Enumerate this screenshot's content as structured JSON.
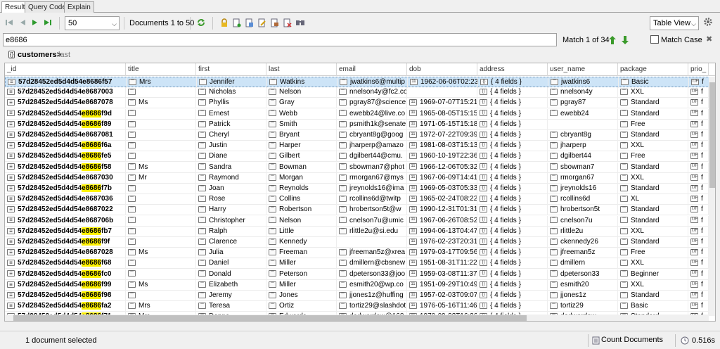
{
  "tabs": [
    {
      "label": "Result",
      "active": true
    },
    {
      "label": "Query Code",
      "active": false
    },
    {
      "label": "Explain",
      "active": false
    }
  ],
  "toolbar": {
    "page_size": "50",
    "documents_label": "Documents 1 to 50",
    "view_mode": "Table View"
  },
  "search": {
    "value": "e8686",
    "match_text": "Match 1 of 34",
    "match_case_label": "Match Case",
    "match_case_checked": false
  },
  "breadcrumb": {
    "collection": "customers>",
    "field": "last"
  },
  "columns": [
    "_id",
    "title",
    "first",
    "last",
    "email",
    "dob",
    "address",
    "user_name",
    "package",
    "prio_"
  ],
  "rows": [
    {
      "id_prefix": "57d28452ed5d4d54e8686f57",
      "id_hl": "",
      "id_suffix": "",
      "title": "Mrs",
      "first": "Jennifer",
      "last": "Watkins",
      "email": "jwatkins6@multip",
      "dob": "1962-06-06T02:23",
      "address": "{ 4 fields }",
      "user_name": "jwatkins6",
      "package": "Basic",
      "prio": "f",
      "selected": true
    },
    {
      "id_prefix": "57d28452ed5d4d54e8687003",
      "id_hl": "",
      "id_suffix": "",
      "title": "",
      "first": "Nicholas",
      "last": "Nelson",
      "email": "nnelson4y@fc2.co",
      "dob": "",
      "address": "{ 4 fields }",
      "user_name": "nnelson4y",
      "package": "XXL",
      "prio": "f"
    },
    {
      "id_prefix": "57d28452ed5d4d54e8687078",
      "id_hl": "",
      "id_suffix": "",
      "title": "Ms",
      "first": "Phyllis",
      "last": "Gray",
      "email": "pgray87@science",
      "dob": "1969-07-07T15:21",
      "address": "{ 4 fields }",
      "user_name": "pgray87",
      "package": "Standard",
      "prio": "f"
    },
    {
      "id_prefix": "57d28452ed5d4d54",
      "id_hl": "e8686",
      "id_suffix": "f9d",
      "title": "",
      "first": "Ernest",
      "last": "Webb",
      "email": "ewebb24@live.co",
      "dob": "1965-08-05T15:15",
      "address": "{ 4 fields }",
      "user_name": "ewebb24",
      "package": "Standard",
      "prio": "f"
    },
    {
      "id_prefix": "57d28452ed5d4d54",
      "id_hl": "e8686",
      "id_suffix": "f89",
      "title": "",
      "first": "Patrick",
      "last": "Smith",
      "email": "psmith1k@senate",
      "dob": "1971-05-15T15:18",
      "address": "{ 4 fields }",
      "user_name": "",
      "package": "Free",
      "prio": "f"
    },
    {
      "id_prefix": "57d28452ed5d4d54e8687081",
      "id_hl": "",
      "id_suffix": "",
      "title": "",
      "first": "Cheryl",
      "last": "Bryant",
      "email": "cbryant8g@goog",
      "dob": "1972-07-22T09:39",
      "address": "{ 4 fields }",
      "user_name": "cbryant8g",
      "package": "Standard",
      "prio": "f"
    },
    {
      "id_prefix": "57d28452ed5d4d54",
      "id_hl": "e8686",
      "id_suffix": "f6a",
      "title": "",
      "first": "Justin",
      "last": "Harper",
      "email": "jharperp@amazo",
      "dob": "1981-08-03T15:13",
      "address": "{ 4 fields }",
      "user_name": "jharperp",
      "package": "XXL",
      "prio": "f"
    },
    {
      "id_prefix": "57d28452ed5d4d54",
      "id_hl": "e8686",
      "id_suffix": "fe5",
      "title": "",
      "first": "Diane",
      "last": "Gilbert",
      "email": "dgilbert44@cmu.",
      "dob": "1960-10-19T22:36",
      "address": "{ 4 fields }",
      "user_name": "dgilbert44",
      "package": "Free",
      "prio": "f"
    },
    {
      "id_prefix": "57d28452ed5d4d54",
      "id_hl": "e8686",
      "id_suffix": "f58",
      "title": "Ms",
      "first": "Sandra",
      "last": "Bowman",
      "email": "sbowman7@phot",
      "dob": "1966-12-06T05:32",
      "address": "{ 4 fields }",
      "user_name": "sbowman7",
      "package": "Standard",
      "prio": "f"
    },
    {
      "id_prefix": "57d28452ed5d4d54e8687030",
      "id_hl": "",
      "id_suffix": "",
      "title": "Mr",
      "first": "Raymond",
      "last": "Morgan",
      "email": "rmorgan67@mys",
      "dob": "1967-06-09T14:41",
      "address": "{ 4 fields }",
      "user_name": "rmorgan67",
      "package": "XXL",
      "prio": "f"
    },
    {
      "id_prefix": "57d28452ed5d4d54",
      "id_hl": "e8686",
      "id_suffix": "f7b",
      "title": "",
      "first": "Joan",
      "last": "Reynolds",
      "email": "jreynolds16@ima",
      "dob": "1969-05-03T05:33",
      "address": "{ 4 fields }",
      "user_name": "jreynolds16",
      "package": "Standard",
      "prio": "f"
    },
    {
      "id_prefix": "57d28452ed5d4d54e8687036",
      "id_hl": "",
      "id_suffix": "",
      "title": "",
      "first": "Rose",
      "last": "Collins",
      "email": "rcollins6d@twitp",
      "dob": "1965-02-24T08:22",
      "address": "{ 4 fields }",
      "user_name": "rcollins6d",
      "package": "XL",
      "prio": "f"
    },
    {
      "id_prefix": "57d28452ed5d4d54e8687022",
      "id_hl": "",
      "id_suffix": "",
      "title": "",
      "first": "Harry",
      "last": "Robertson",
      "email": "hrobertson5t@w",
      "dob": "1990-12-31T01:31",
      "address": "{ 4 fields }",
      "user_name": "hrobertson5t",
      "package": "Standard",
      "prio": "f"
    },
    {
      "id_prefix": "57d28452ed5d4d54e868706b",
      "id_hl": "",
      "id_suffix": "",
      "title": "",
      "first": "Christopher",
      "last": "Nelson",
      "email": "cnelson7u@umic",
      "dob": "1967-06-26T08:52",
      "address": "{ 4 fields }",
      "user_name": "cnelson7u",
      "package": "Standard",
      "prio": "f"
    },
    {
      "id_prefix": "57d28452ed5d4d54",
      "id_hl": "e8686",
      "id_suffix": "fb7",
      "title": "",
      "first": "Ralph",
      "last": "Little",
      "email": "rlittle2u@si.edu",
      "dob": "1994-06-13T04:47",
      "address": "{ 4 fields }",
      "user_name": "rlittle2u",
      "package": "XXL",
      "prio": "f"
    },
    {
      "id_prefix": "57d28452ed5d4d54",
      "id_hl": "e8686",
      "id_suffix": "f9f",
      "title": "",
      "first": "Clarence",
      "last": "Kennedy",
      "email": "",
      "dob": "1976-02-23T20:31",
      "address": "{ 4 fields }",
      "user_name": "ckennedy26",
      "package": "Standard",
      "prio": "f"
    },
    {
      "id_prefix": "57d28452ed5d4d54e8687028",
      "id_hl": "",
      "id_suffix": "",
      "title": "Ms",
      "first": "Julia",
      "last": "Freeman",
      "email": "jfreeman5z@xrea",
      "dob": "1979-03-17T09:56",
      "address": "{ 4 fields }",
      "user_name": "jfreeman5z",
      "package": "Free",
      "prio": "f"
    },
    {
      "id_prefix": "57d28452ed5d4d54",
      "id_hl": "e8686",
      "id_suffix": "f68",
      "title": "",
      "first": "Daniel",
      "last": "Miller",
      "email": "dmillern@cbsnew",
      "dob": "1951-08-31T11:22",
      "address": "{ 4 fields }",
      "user_name": "dmillern",
      "package": "XXL",
      "prio": "f"
    },
    {
      "id_prefix": "57d28452ed5d4d54",
      "id_hl": "e8686",
      "id_suffix": "fc0",
      "title": "",
      "first": "Donald",
      "last": "Peterson",
      "email": "dpeterson33@joo",
      "dob": "1959-03-08T11:37",
      "address": "{ 4 fields }",
      "user_name": "dpeterson33",
      "package": "Beginner",
      "prio": "f"
    },
    {
      "id_prefix": "57d28452ed5d4d54",
      "id_hl": "e8686",
      "id_suffix": "f99",
      "title": "Ms",
      "first": "Elizabeth",
      "last": "Miller",
      "email": "esmith20@wp.co",
      "dob": "1951-09-29T10:49",
      "address": "{ 4 fields }",
      "user_name": "esmith20",
      "package": "XXL",
      "prio": "f"
    },
    {
      "id_prefix": "57d28452ed5d4d54",
      "id_hl": "e8686",
      "id_suffix": "f98",
      "title": "",
      "first": "Jeremy",
      "last": "Jones",
      "email": "jjones1z@huffing",
      "dob": "1957-02-03T09:07",
      "address": "{ 4 fields }",
      "user_name": "jjones1z",
      "package": "Standard",
      "prio": "f"
    },
    {
      "id_prefix": "57d28452ed5d4d54",
      "id_hl": "e8686",
      "id_suffix": "fa2",
      "title": "Mrs",
      "first": "Teresa",
      "last": "Ortiz",
      "email": "tortiz29@slashdot",
      "dob": "1976-05-16T11:46",
      "address": "{ 4 fields }",
      "user_name": "tortiz29",
      "package": "Basic",
      "prio": "f"
    },
    {
      "id_prefix": "57d28452ed5d4d54",
      "id_hl": "e8686",
      "id_suffix": "f71",
      "title": "Mrs",
      "first": "Donna",
      "last": "Edwards",
      "email": "dedwardsw@168",
      "dob": "1970-09-22T16:26",
      "address": "{ 4 fields }",
      "user_name": "dedwardsw",
      "package": "Standard",
      "prio": "f"
    }
  ],
  "status": {
    "selection_text": "1 document selected",
    "count_label": "Count Documents",
    "elapsed": "0.516s"
  }
}
